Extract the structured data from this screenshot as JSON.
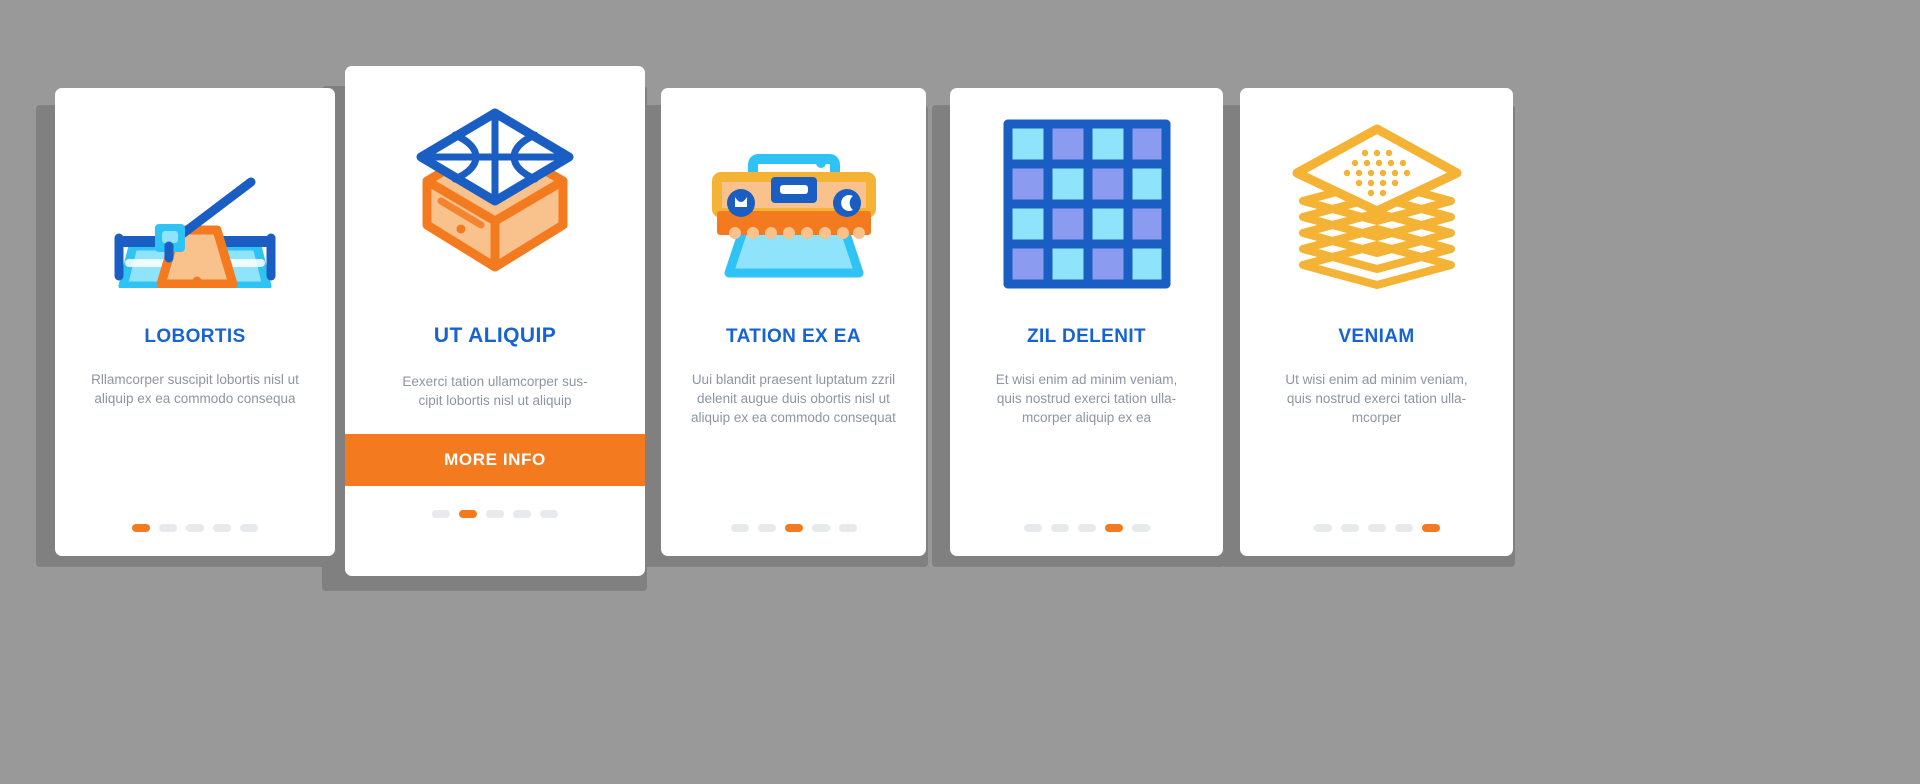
{
  "background_color": "#999999",
  "theme": {
    "card_bg": "#ffffff",
    "title_color": "#1663d1",
    "desc_color": "#8d95a3",
    "accent_orange": "#f47a20",
    "dot_inactive": "#e8e9ec",
    "icon_blue_dark": "#1a5ec4",
    "icon_blue_light": "#2fc3f5",
    "icon_blue_pale": "#8fe3fb",
    "icon_purple": "#8b9bf0",
    "icon_orange": "#f47a20",
    "icon_orange_pale": "#f9c18b",
    "icon_yellow": "#f5b335"
  },
  "cards": [
    {
      "id": "lobortis",
      "icon_name": "paper-trimmer-icon",
      "title": "LOBORTIS",
      "description": "Rllamcorper suscipit lobortis nisl ut aliquip ex ea commodo consequa",
      "has_cta": false,
      "cta_label": "",
      "dots_total": 5,
      "dot_active_index": 1
    },
    {
      "id": "ut-aliquip",
      "icon_name": "stacked-paper-sheets-icon",
      "title": "UT ALIQUIP",
      "description": "Eexerci tation ullamcorper sus-cipit lobortis nisl ut aliquip",
      "has_cta": true,
      "cta_label": "MORE INFO",
      "dots_total": 5,
      "dot_active_index": 2
    },
    {
      "id": "tation-ex-ea",
      "icon_name": "paper-cutting-machine-icon",
      "title": "TATION EX EA",
      "description": "Uui blandit praesent luptatum zzril delenit augue duis obortis nisl ut aliquip ex ea commodo consequat",
      "has_cta": false,
      "cta_label": "",
      "dots_total": 5,
      "dot_active_index": 3
    },
    {
      "id": "zil-delenit",
      "icon_name": "checker-grid-icon",
      "title": "ZIL DELENIT",
      "description": "Et wisi enim ad minim veniam, quis nostrud exerci tation ulla-mcorper aliquip ex ea",
      "has_cta": false,
      "cta_label": "",
      "dots_total": 5,
      "dot_active_index": 4
    },
    {
      "id": "veniam",
      "icon_name": "paper-stack-layers-icon",
      "title": "VENIAM",
      "description": "Ut wisi enim ad minim veniam, quis nostrud exerci tation ulla-mcorper",
      "has_cta": false,
      "cta_label": "",
      "dots_total": 5,
      "dot_active_index": 5
    }
  ]
}
